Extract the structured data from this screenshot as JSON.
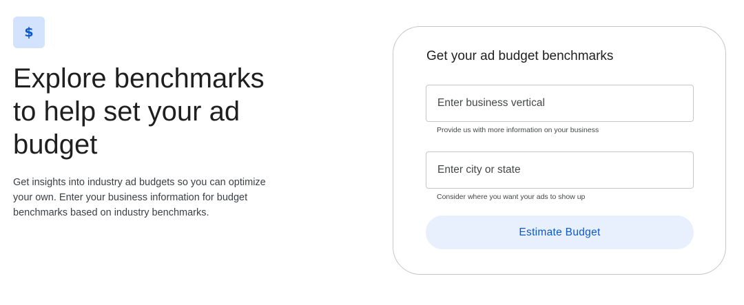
{
  "hero": {
    "icon": "dollar-sign-icon",
    "icon_glyph": "$",
    "headline": "Explore benchmarks to help set your ad budget",
    "description": "Get insights into industry ad budgets so you can optimize your own. Enter your business information for budget benchmarks based on industry benchmarks."
  },
  "form": {
    "title": "Get your ad budget benchmarks",
    "vertical": {
      "placeholder": "Enter business vertical",
      "value": "",
      "helper": "Provide us with more information on your business"
    },
    "location": {
      "placeholder": "Enter city or state",
      "value": "",
      "helper": "Consider where you want your ads to show up"
    },
    "submit_label": "Estimate Budget"
  },
  "colors": {
    "accent": "#0b57d0",
    "badge_bg": "#d3e3fd",
    "button_bg": "#e8f0fe",
    "border": "#c4c7c5"
  }
}
